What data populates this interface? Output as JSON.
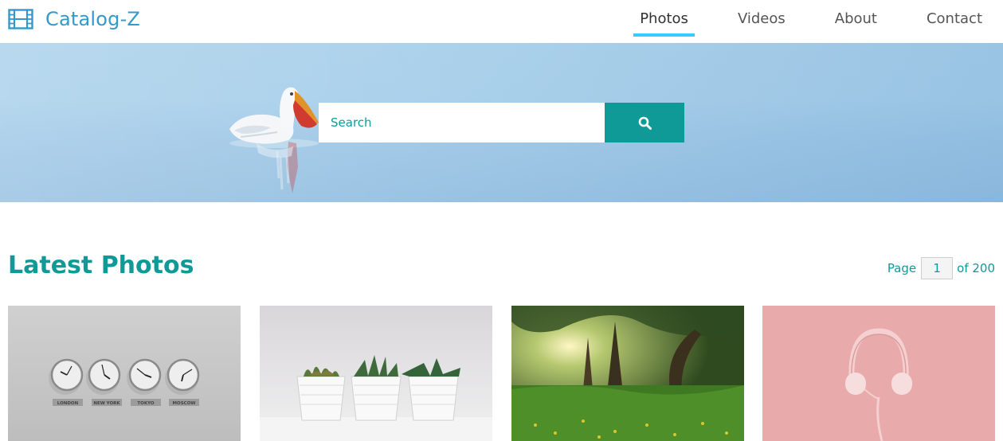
{
  "brand": {
    "name": "Catalog-Z",
    "icon": "film-icon"
  },
  "nav": {
    "items": [
      {
        "label": "Photos",
        "active": true
      },
      {
        "label": "Videos",
        "active": false
      },
      {
        "label": "About",
        "active": false
      },
      {
        "label": "Contact",
        "active": false
      }
    ]
  },
  "search": {
    "placeholder": "Search",
    "value": "",
    "button_icon": "search-icon"
  },
  "section": {
    "title": "Latest Photos"
  },
  "pagination": {
    "prefix": "Page",
    "current": "1",
    "suffix": "of 200"
  },
  "gallery": {
    "items": [
      {
        "subject": "world-clocks",
        "clock_labels": [
          "LONDON",
          "NEW YORK",
          "TOKYO",
          "MOSCOW"
        ]
      },
      {
        "subject": "succulents-in-pots"
      },
      {
        "subject": "forest-meadow"
      },
      {
        "subject": "pink-headphones"
      }
    ]
  },
  "colors": {
    "accent": "#0f9a98",
    "brand": "#3399cc",
    "nav_active": "#33ccff"
  }
}
